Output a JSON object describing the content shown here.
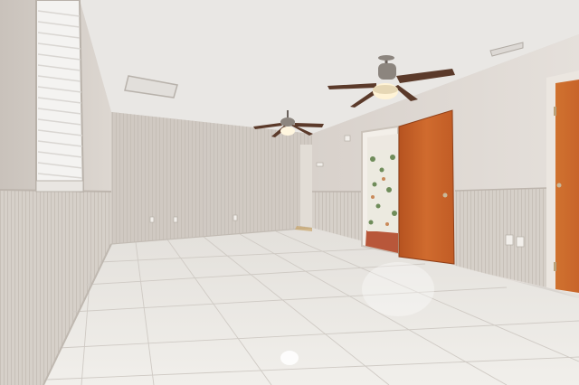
{
  "scene": {
    "kind": "photo",
    "colors": {
      "ceiling": "#e9e7e4",
      "wall": "#dcd6d0",
      "wainscot": "#d3cdc6",
      "floor": "#e8e5e0",
      "door": "#c8642a",
      "fan_blade": "#5b3a2a"
    },
    "objects": [
      "window-with-blinds",
      "ceiling-fan-near",
      "ceiling-fan-far",
      "orange-door-open",
      "orange-door-right",
      "doorway-to-bathroom",
      "shower-curtain",
      "hvac-vents",
      "wall-outlets",
      "tile-floor"
    ]
  }
}
